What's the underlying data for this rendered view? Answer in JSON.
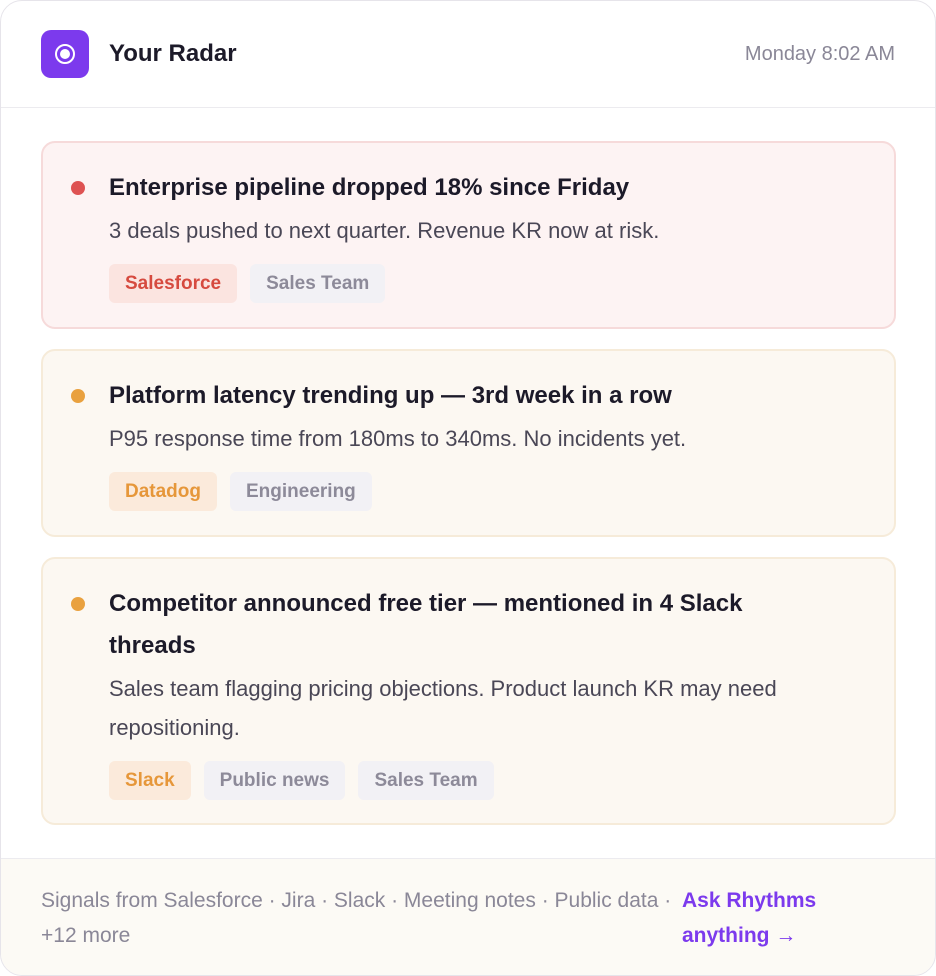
{
  "header": {
    "title": "Your Radar",
    "timestamp": "Monday 8:02 AM",
    "logo_icon": "radar-icon",
    "accent": "#7c3aed"
  },
  "signals": [
    {
      "severity": "high",
      "severity_color": "#de5252",
      "title": "Enterprise pipeline dropped 18% since Friday",
      "description": "3 deals pushed to next quarter. Revenue KR now at risk.",
      "tags": [
        "Salesforce",
        "Sales Team"
      ]
    },
    {
      "severity": "medium",
      "severity_color": "#e9a13f",
      "title": "Platform latency trending up — 3rd week in a row",
      "description": "P95 response time from 180ms to 340ms. No incidents yet.",
      "tags": [
        "Datadog",
        "Engineering"
      ]
    },
    {
      "severity": "medium",
      "severity_color": "#e9a13f",
      "title": "Competitor announced free tier — mentioned in 4 Slack threads",
      "description": "Sales team flagging pricing objections. Product launch KR may need repositioning.",
      "tags": [
        "Slack",
        "Public news",
        "Sales Team"
      ]
    }
  ],
  "footer": {
    "sources_text": "Signals from Salesforce · Jira · Slack · Meeting notes · Public data · +12 more",
    "cta_label": "Ask Rhythms anything →"
  }
}
